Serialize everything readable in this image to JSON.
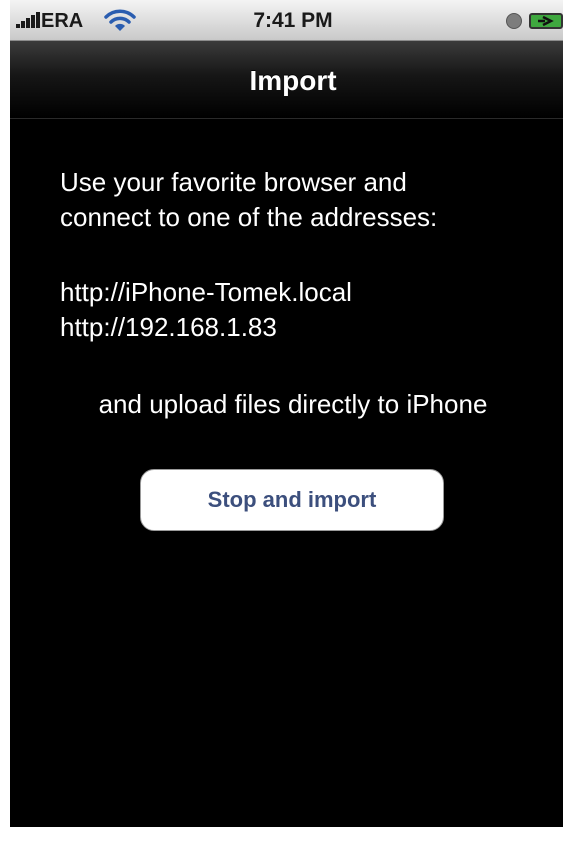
{
  "status_bar": {
    "carrier": "ERA",
    "time": "7:41 PM",
    "icons": [
      "signal-bars-icon",
      "wifi-icon",
      "clock-icon",
      "battery-charging-icon"
    ]
  },
  "nav": {
    "title": "Import"
  },
  "content": {
    "intro_line1": "Use your favorite browser and",
    "intro_line2": "connect to one of the addresses:",
    "addresses": [
      "http://iPhone-Tomek.local",
      "http://192.168.1.83"
    ],
    "upload_text": "and upload files directly to iPhone"
  },
  "button": {
    "label": "Stop and import"
  },
  "colors": {
    "background": "#000000",
    "text": "#ffffff",
    "button_text": "#3c4f7d",
    "status_bar": "#e0e0e0"
  }
}
